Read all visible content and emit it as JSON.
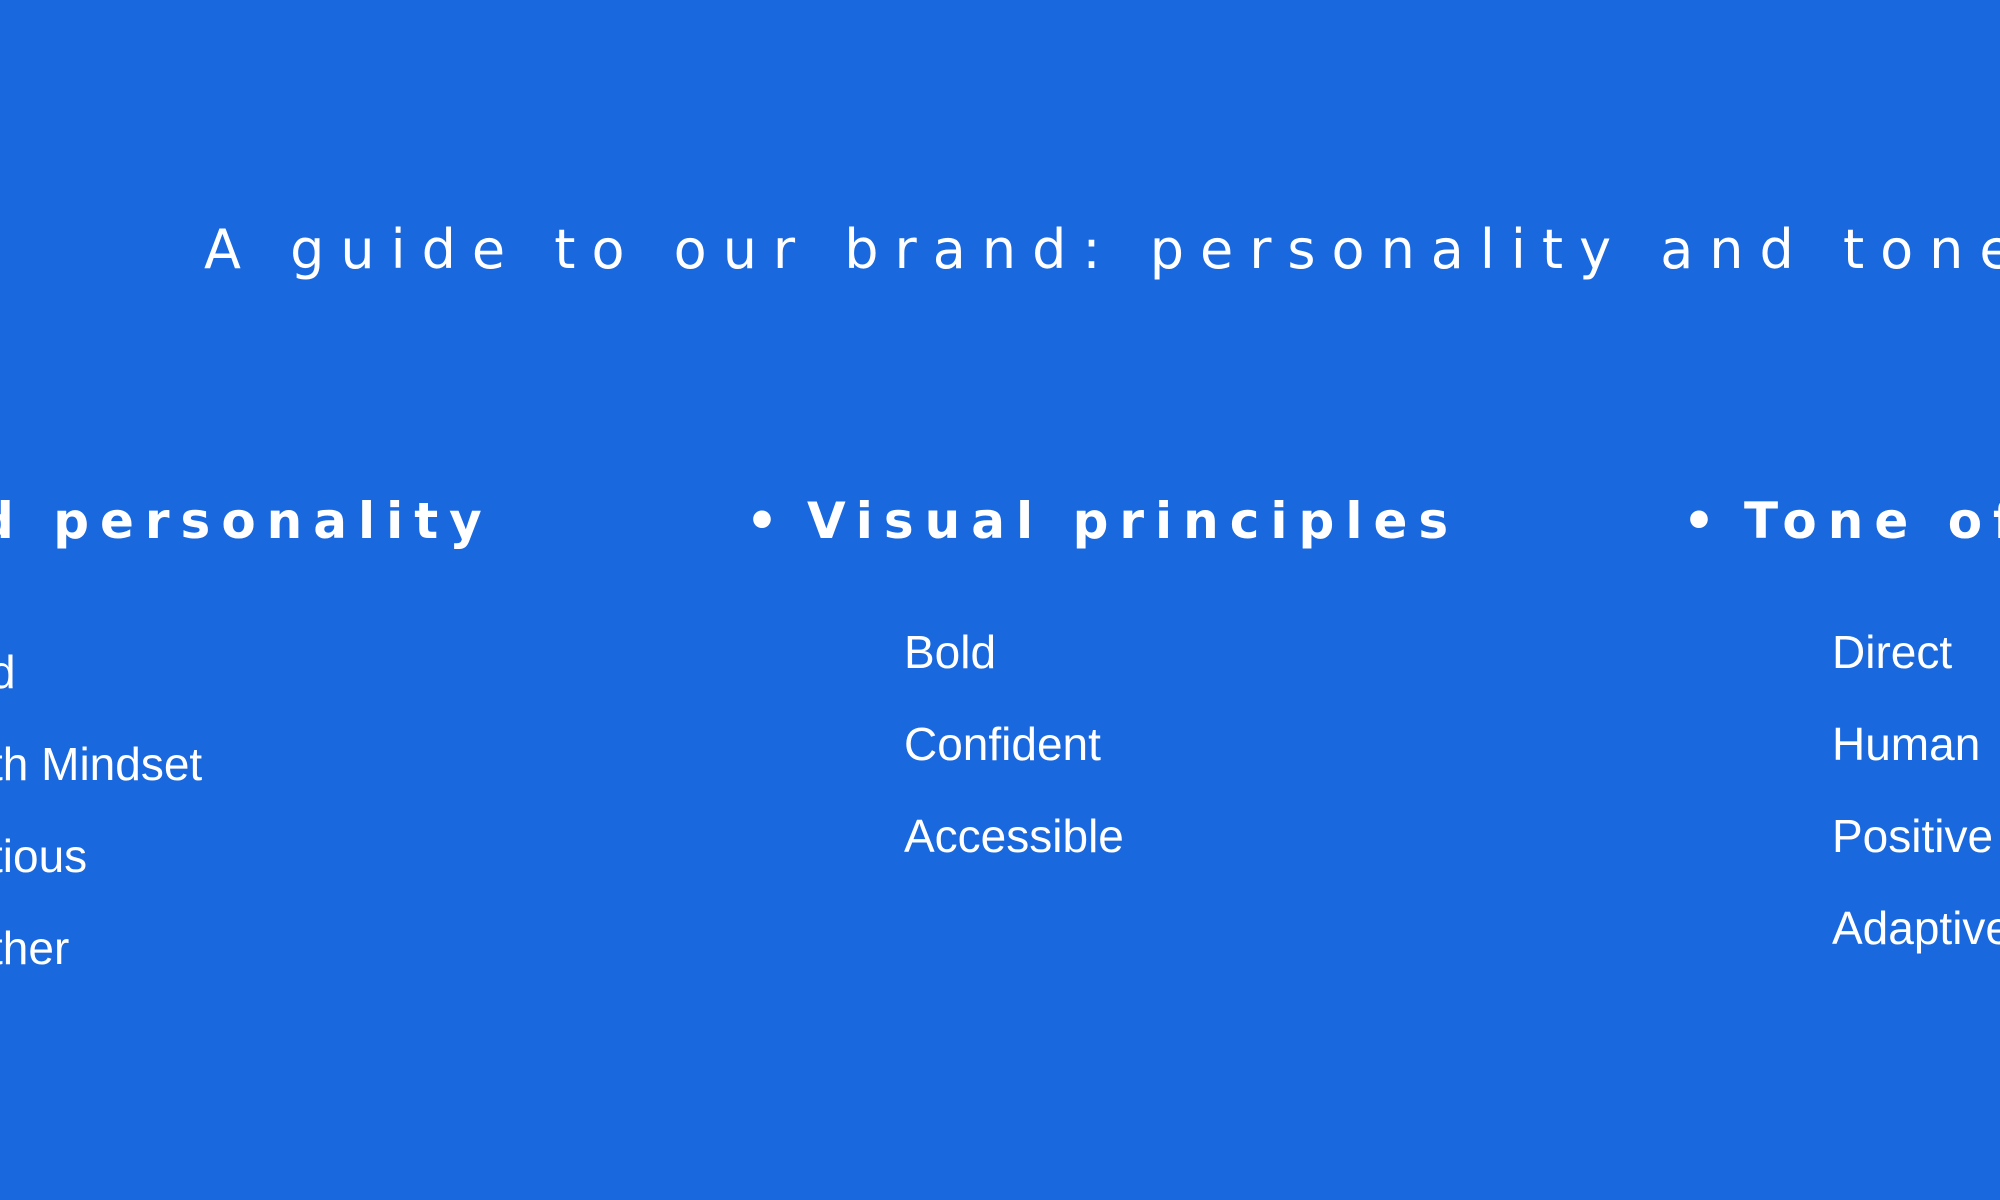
{
  "colors": {
    "background": "#1a68de",
    "text": "#ffffff"
  },
  "title": "A guide to our brand: personality and tone",
  "sections": [
    {
      "heading": "d personality",
      "bullet": "",
      "items": [
        "d",
        "th Mindset",
        "tious",
        "ther"
      ]
    },
    {
      "heading": "Visual principles",
      "bullet": "•",
      "items": [
        "Bold",
        "Confident",
        "Accessible"
      ]
    },
    {
      "heading": "Tone of",
      "bullet": "•",
      "items": [
        "Direct",
        "Human",
        "Positive",
        "Adaptive"
      ]
    }
  ]
}
